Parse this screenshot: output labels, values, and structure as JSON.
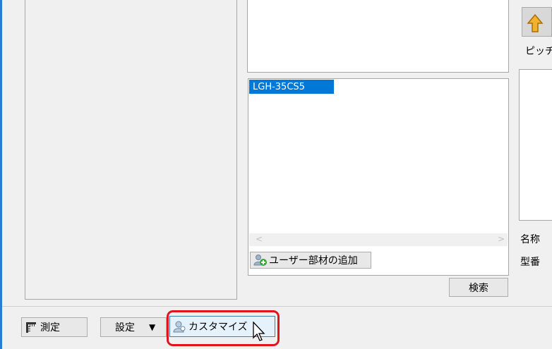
{
  "list": {
    "items": [
      "LGH-35CS5"
    ]
  },
  "buttons": {
    "add_user_part": "ユーザー部材の追加",
    "search": "検索",
    "measure": "測定",
    "settings": "設定",
    "customize": "カスタマイズ"
  },
  "side_panel": {
    "pitch_label": "ピッチ",
    "name_label": "名称",
    "model_label": "型番"
  },
  "colors": {
    "highlight": "#e0151c",
    "selection": "#0078d7"
  }
}
